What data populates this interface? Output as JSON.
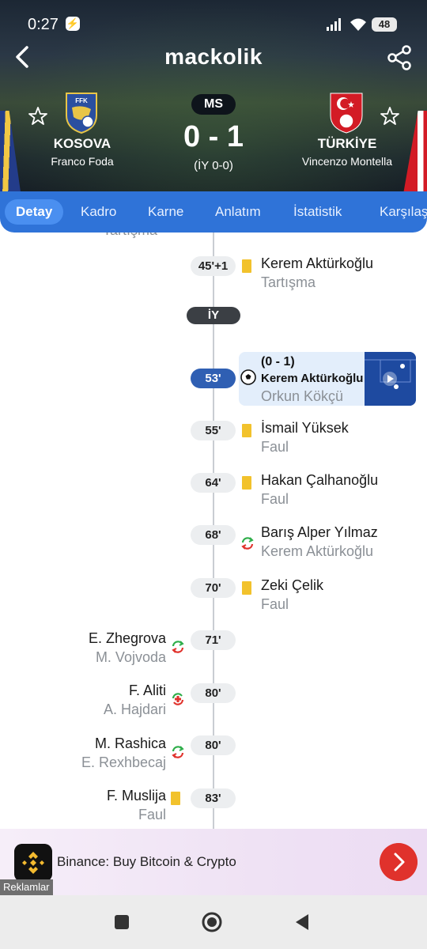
{
  "status_bar": {
    "time": "0:27",
    "battery": "48"
  },
  "app": {
    "title": "mackolik"
  },
  "match": {
    "status": "MS",
    "score": "0 - 1",
    "half_time": "(İY 0-0)",
    "home": {
      "name": "KOSOVA",
      "coach": "Franco Foda",
      "crest_text": "FFK"
    },
    "away": {
      "name": "TÜRKİYE",
      "coach": "Vincenzo Montella"
    }
  },
  "tabs": [
    {
      "label": "Detay",
      "active": true
    },
    {
      "label": "Kadro"
    },
    {
      "label": "Karne"
    },
    {
      "label": "Anlatım"
    },
    {
      "label": "İstatistik"
    },
    {
      "label": "Karşılaş"
    }
  ],
  "timeline": {
    "cutoff_text": "Tartışma",
    "halftime_label": "İY",
    "events": [
      {
        "minute": "45'+1",
        "side": "away",
        "type": "yellow-card",
        "player": "Kerem Aktürkoğlu",
        "detail": "Tartışma"
      },
      {
        "minute": "53'",
        "side": "away",
        "type": "goal",
        "score": "(0 - 1)",
        "player": "Kerem Aktürkoğlu",
        "detail": "Orkun Kökçü"
      },
      {
        "minute": "55'",
        "side": "away",
        "type": "yellow-card",
        "player": "İsmail Yüksek",
        "detail": "Faul"
      },
      {
        "minute": "64'",
        "side": "away",
        "type": "yellow-card",
        "player": "Hakan Çalhanoğlu",
        "detail": "Faul"
      },
      {
        "minute": "68'",
        "side": "away",
        "type": "substitution",
        "player": "Barış Alper Yılmaz",
        "detail": "Kerem Aktürkoğlu"
      },
      {
        "minute": "70'",
        "side": "away",
        "type": "yellow-card",
        "player": "Zeki Çelik",
        "detail": "Faul"
      },
      {
        "minute": "71'",
        "side": "home",
        "type": "substitution",
        "player": "E. Zhegrova",
        "detail": "M. Vojvoda"
      },
      {
        "minute": "80'",
        "side": "home",
        "type": "injury-substitution",
        "player": "F. Aliti",
        "detail": "A. Hajdari"
      },
      {
        "minute": "80'",
        "side": "home",
        "type": "substitution",
        "player": "M. Rashica",
        "detail": "E. Rexhbecaj"
      },
      {
        "minute": "83'",
        "side": "home",
        "type": "yellow-card",
        "player": "F. Muslija",
        "detail": "Faul"
      }
    ]
  },
  "ad": {
    "title": "Binance: Buy Bitcoin & Crypto",
    "label": "Reklamlar"
  },
  "colors": {
    "primary": "#2f73d8",
    "goal_pill": "#2f5fb3",
    "yellow_card": "#f2c22c",
    "sub_in": "#2fae4a",
    "sub_out": "#e0322c",
    "ad_button": "#e0322c"
  }
}
